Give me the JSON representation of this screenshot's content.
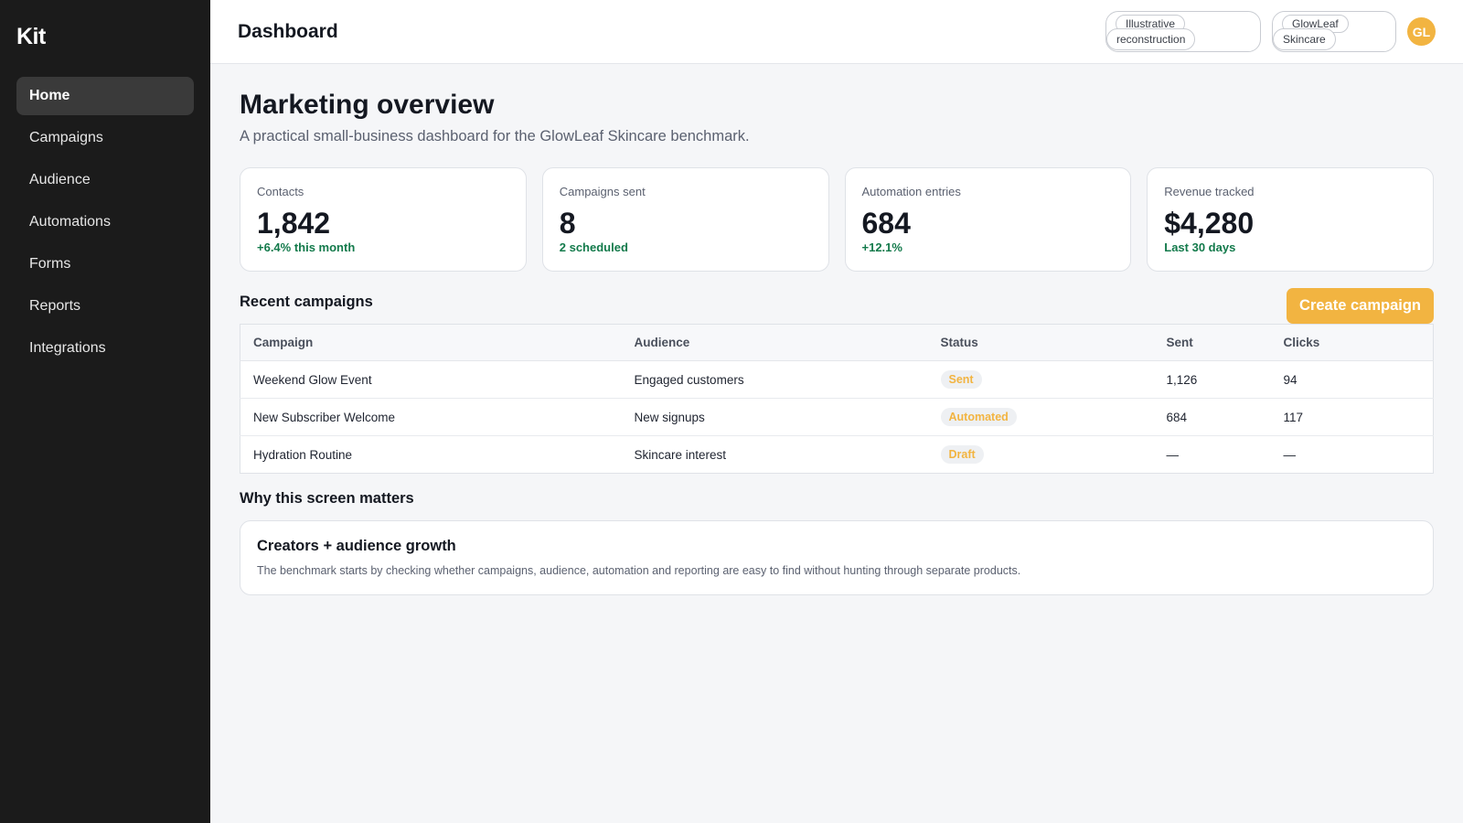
{
  "sidebar": {
    "brand": "Kit",
    "items": [
      {
        "label": "Home",
        "active": true
      },
      {
        "label": "Campaigns"
      },
      {
        "label": "Audience"
      },
      {
        "label": "Automations"
      },
      {
        "label": "Forms"
      },
      {
        "label": "Reports"
      },
      {
        "label": "Integrations"
      }
    ]
  },
  "header": {
    "title": "Dashboard",
    "chip1": {
      "line1": "Illustrative",
      "line2": "reconstruction"
    },
    "chip2": {
      "line1": "GlowLeaf",
      "line2": "Skincare"
    },
    "avatar": "GL"
  },
  "main": {
    "title": "Marketing overview",
    "subtitle": "A practical small-business dashboard for the GlowLeaf Skincare benchmark.",
    "stats": [
      {
        "label": "Contacts",
        "value": "1,842",
        "note": "+6.4% this month"
      },
      {
        "label": "Campaigns sent",
        "value": "8",
        "note": "2 scheduled"
      },
      {
        "label": "Automation entries",
        "value": "684",
        "note": "+12.1%"
      },
      {
        "label": "Revenue tracked",
        "value": "$4,280",
        "note": "Last 30 days"
      }
    ],
    "recent": {
      "title": "Recent campaigns",
      "create_label": "Create campaign",
      "columns": [
        "Campaign",
        "Audience",
        "Status",
        "Sent",
        "Clicks"
      ],
      "rows": [
        {
          "campaign": "Weekend Glow Event",
          "audience": "Engaged customers",
          "status": "Sent",
          "sent": "1,126",
          "clicks": "94"
        },
        {
          "campaign": "New Subscriber Welcome",
          "audience": "New signups",
          "status": "Automated",
          "sent": "684",
          "clicks": "117"
        },
        {
          "campaign": "Hydration Routine",
          "audience": "Skincare interest",
          "status": "Draft",
          "sent": "—",
          "clicks": "—"
        }
      ]
    },
    "why": {
      "title": "Why this screen matters",
      "card_title": "Creators + audience growth",
      "card_text": "The benchmark starts by checking whether campaigns, audience, automation and reporting are easy to find without hunting through separate products."
    }
  },
  "colors": {
    "sidebar_bg": "#1b1b1b",
    "accent": "#f2b441",
    "positive": "#137a4b"
  }
}
